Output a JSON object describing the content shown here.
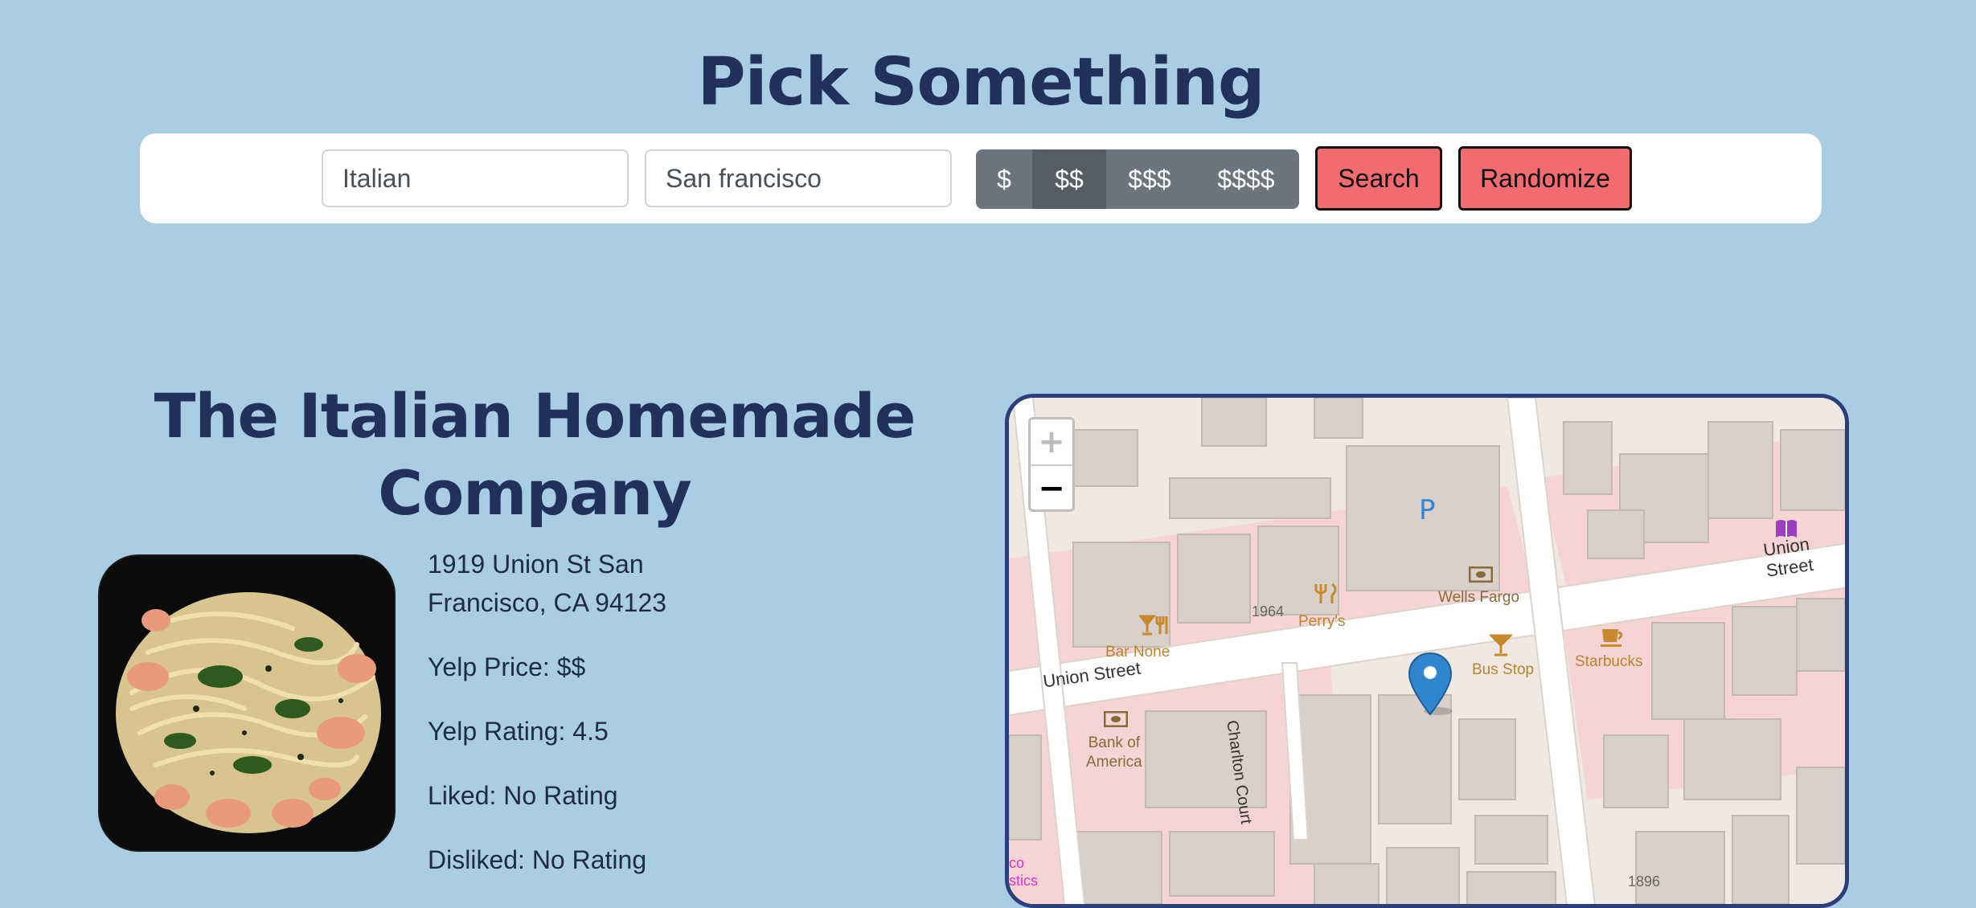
{
  "header": {
    "title": "Pick Something"
  },
  "search": {
    "cuisine_value": "Italian",
    "location_value": "San francisco",
    "price_options": [
      "$",
      "$$",
      "$$$",
      "$$$$"
    ],
    "selected_price": "$$",
    "search_label": "Search",
    "randomize_label": "Randomize"
  },
  "restaurant": {
    "name_line1": "The Italian Homemade",
    "name_line2": "Company",
    "address_line1": "1919 Union St San",
    "address_line2": "Francisco, CA 94123",
    "price": "Yelp Price: $$",
    "rating": "Yelp Rating: 4.5",
    "liked": "Liked: No Rating",
    "disliked": "Disliked: No Rating"
  },
  "map": {
    "zoom_in": "+",
    "zoom_out": "−",
    "parking": "P",
    "streets": {
      "union_left": "Union Street",
      "union_right": "Union Street",
      "charlton": "Charlton Court"
    },
    "pois": {
      "bar_none": "Bar None",
      "perrys": "Perry's",
      "wells_fargo": "Wells Fargo",
      "bus_stop": "Bus Stop",
      "starbucks": "Starbucks",
      "bank_line1": "Bank of",
      "bank_line2": "America"
    },
    "numbers": {
      "n1964": "1964",
      "n1896": "1896"
    },
    "edge_text": {
      "line1": "co",
      "line2": "stics"
    }
  }
}
